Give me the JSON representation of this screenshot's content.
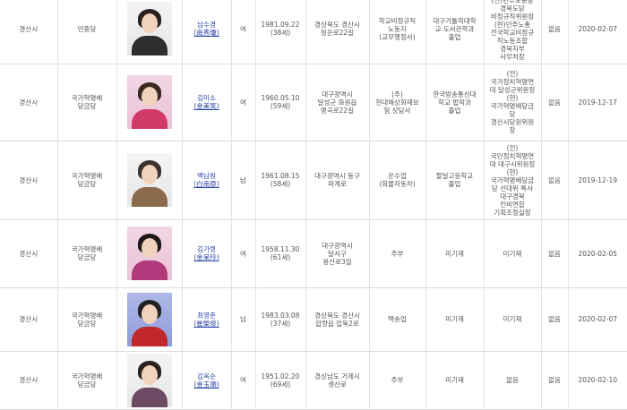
{
  "rows": [
    {
      "region": "경산시",
      "party": "민중당",
      "name": "남수경",
      "hanja": "(南秀瓊)",
      "gender": "여",
      "birth": "1981.09.22\n(38세)",
      "address": "경상북도 경산시\n청운로22길",
      "job": "학교비정규직\n노동자\n(교무행정사)",
      "education": "대구가톨릭대학\n교 도서관학과\n졸업",
      "career": "(전)민주노총당\n경북도당\n비정규직위원장\n(현)민주노총\n전국학교비정규\n직노동조합\n경북지부\n사무처장",
      "criminal": "없음",
      "date": "2020-02-07",
      "photo": {
        "bg": "plain",
        "hair": "#2a211e",
        "cloth": "#2e2e2e"
      }
    },
    {
      "region": "경산시",
      "party": "국가혁명배\n당금당",
      "name": "김미소",
      "hanja": "(金美笑)",
      "gender": "여",
      "birth": "1960.05.10\n(59세)",
      "address": "대구광역시\n달성군 화원읍\n명곡로22길",
      "job": "(주)\n현대해상화재보\n험 상담사",
      "education": "한국방송통신대\n학교 법학과\n졸업",
      "career": "(전)\n국가정치혁명연\n대 달성군위원장\n(현)\n국가혁명배당금\n당\n경산시당원위원\n장",
      "criminal": "없음",
      "date": "2019-12-17",
      "photo": {
        "bg": "pink",
        "hair": "#3a2a22",
        "cloth": "#d23a6a"
      }
    },
    {
      "region": "경산시",
      "party": "국가혁명배\n당금당",
      "name": "백남원",
      "hanja": "(白南原)",
      "gender": "남",
      "birth": "1961.08.15\n(58세)",
      "address": "대구광역시 동구\n파계로",
      "job": "운수업\n(화물자동차)",
      "education": "팔달고등학교\n졸업",
      "career": "(전)\n국민정치혁명연\n대 대구시위원장\n(현)\n국가혁명배당금\n당 선대위 특사\n대구경북\n인비연합\n기획조정실장",
      "criminal": "없음",
      "date": "2019-12-19",
      "photo": {
        "bg": "plain",
        "hair": "#3b332e",
        "cloth": "#8a6a4a"
      }
    },
    {
      "region": "경산시",
      "party": "국가혁명배\n당금당",
      "name": "김가령",
      "hanja": "(金呆玲)",
      "gender": "여",
      "birth": "1958.11.30\n(61세)",
      "address": "대구광역시\n달서구\n용산로3길",
      "job": "주부",
      "education": "미기재",
      "career": "미기재",
      "criminal": "없음",
      "date": "2020-02-05",
      "photo": {
        "bg": "pink",
        "hair": "#1e1a1a",
        "cloth": "#b03a7a"
      }
    },
    {
      "region": "경산시",
      "party": "국가혁명배\n당금당",
      "name": "최영준",
      "hanja": "(崔榮俊)",
      "gender": "남",
      "birth": "1983.03.08\n(37세)",
      "address": "경상북도 경산시\n압량읍 압독2로",
      "job": "택송업",
      "education": "미기재",
      "career": "미기재",
      "criminal": "없음",
      "date": "2020-02-07",
      "photo": {
        "bg": "blue",
        "hair": "#222222",
        "cloth": "#c0282e"
      }
    },
    {
      "region": "경산시",
      "party": "국가혁명배\n당금당",
      "name": "김옥순",
      "hanja": "(金玉順)",
      "gender": "여",
      "birth": "1951.02.20\n(69세)",
      "address": "경상남도 거제시\n생산로",
      "job": "주부",
      "education": "미기재",
      "career": "없음",
      "criminal": "없음",
      "date": "2020-02-10",
      "photo": {
        "bg": "plain",
        "hair": "#2c2320",
        "cloth": "#6d4a63"
      }
    }
  ]
}
